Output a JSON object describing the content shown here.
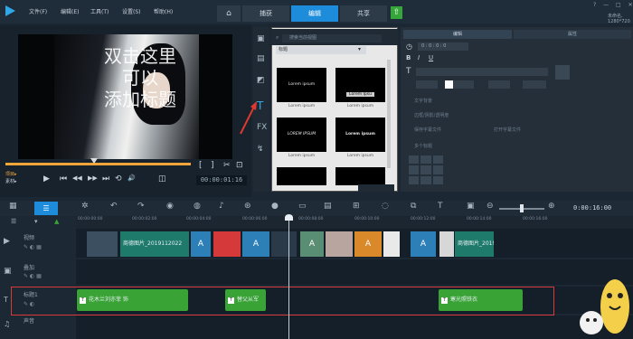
{
  "app": {
    "brand_color": "#2fa7e8"
  },
  "menu": [
    "文件(F)",
    "编辑(E)",
    "工具(T)",
    "设置(S)",
    "帮助(H)"
  ],
  "workspace_tabs": {
    "home_icon": "home-icon",
    "tabs": [
      "捕获",
      "编辑",
      "共享"
    ],
    "active": "编辑"
  },
  "window": {
    "controls": [
      "?",
      "—",
      "□",
      "✕"
    ],
    "project_info": "未命名, 1280*720"
  },
  "preview": {
    "overlay_text": "双击这里\n可以\n添加标题",
    "timecode": "00:00:01:16",
    "controls": {
      "project": "项目▸",
      "clip": "素材▸",
      "play": "▶",
      "prev": "⏮",
      "back": "◀◀",
      "fwd": "▶▶",
      "next": "⏭",
      "repeat": "⟲",
      "volume": "🔊",
      "resize": "◫",
      "mark_in": "[",
      "mark_out": "]",
      "cut": "✂",
      "snapshot": "⊡",
      "enlarge": "⤢"
    }
  },
  "library": {
    "search_placeholder": "搜索当前视图",
    "dropdown": "标题",
    "thumbs": [
      {
        "text": "Lorem ipsum",
        "label": "Lorem ipsum"
      },
      {
        "text": "Lorem Ipsu",
        "label": "Lorem ipsum"
      },
      {
        "text": "LOREM IPSUM",
        "label": "Lorem ipsum"
      },
      {
        "text": "Lorem ipsum",
        "label": "Lorem ipsum"
      }
    ],
    "side_icons": [
      "media-icon",
      "instant-project-icon",
      "transition-icon",
      "title-icon",
      "fx-icon",
      "filter-icon",
      "path-icon"
    ],
    "fx_label": "FX"
  },
  "options": {
    "tabs": [
      "编辑",
      "属性"
    ],
    "time": "0 : 0 : 0 : 0",
    "rows": [
      "文字背景",
      "边框/阴影/透明度",
      "保存字幕文件",
      "打开字幕文件",
      "对齐",
      "多个标题"
    ]
  },
  "timeline": {
    "ruler": [
      "00:00:00:00",
      "00:00:02:00",
      "00:00:04:00",
      "00:00:06:00",
      "00:00:08:00",
      "00:00:10:00",
      "00:00:12:00",
      "00:00:14:00",
      "00:00:16:00"
    ],
    "duration": "0:00:16:00",
    "tracks": [
      {
        "name": "视频",
        "icon": "video-track-icon"
      },
      {
        "name": "叠加",
        "icon": "overlay-track-icon"
      },
      {
        "name": "标题1",
        "icon": "title-track-icon"
      },
      {
        "name": "声音",
        "icon": "voice-track-icon"
      }
    ],
    "video_clips": [
      "商德图片_2019112022",
      "商德图片_2019"
    ],
    "title_clips": [
      "花木兰刘亦菲 饰",
      "替父从军",
      "寒光照铁衣"
    ]
  },
  "colors": {
    "title_clip": "#3aa336",
    "video_clip": "#1e7b6c",
    "highlight": "#d83a3a",
    "active_tab": "#1d8ddb"
  }
}
